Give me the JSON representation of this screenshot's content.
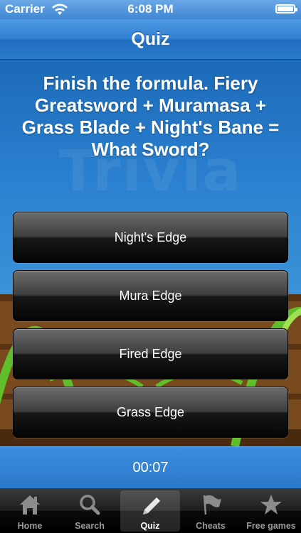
{
  "status_bar": {
    "carrier": "Carrier",
    "time": "6:08 PM"
  },
  "nav": {
    "title": "Quiz"
  },
  "background": {
    "watermark": "Trivia"
  },
  "question": {
    "text": "Finish the formula. Fiery Greatsword + Muramasa + Grass Blade + Night's Bane = What Sword?"
  },
  "answers": [
    {
      "label": "Night's Edge"
    },
    {
      "label": "Mura Edge"
    },
    {
      "label": "Fired Edge"
    },
    {
      "label": "Grass Edge"
    }
  ],
  "timer": {
    "value": "00:07"
  },
  "tab_bar": {
    "active": "Quiz",
    "tabs": [
      {
        "label": "Home",
        "icon": "home-icon"
      },
      {
        "label": "Search",
        "icon": "search-icon"
      },
      {
        "label": "Quiz",
        "icon": "pencil-icon"
      },
      {
        "label": "Cheats",
        "icon": "flag-icon"
      },
      {
        "label": "Free games",
        "icon": "star-icon"
      }
    ]
  },
  "colors": {
    "primary_blue": "#2a78c8",
    "button_dark": "#171717",
    "tab_bar": "#000000"
  }
}
